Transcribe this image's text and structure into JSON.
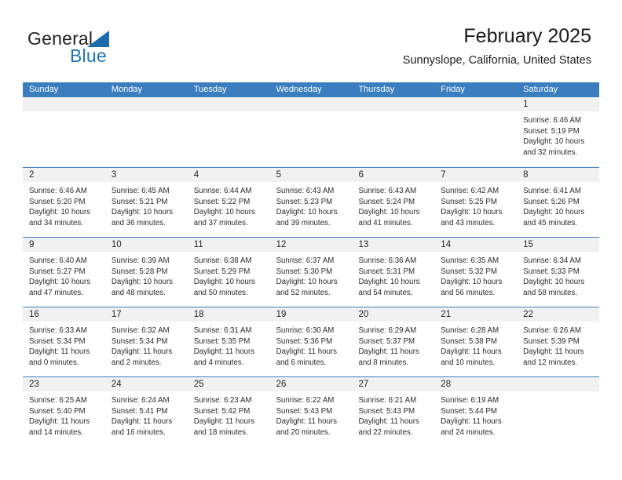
{
  "brand": {
    "name_top": "General",
    "name_bottom": "Blue",
    "accent_color": "#1b6cac"
  },
  "header": {
    "title": "February 2025",
    "location": "Sunnyslope, California, United States"
  },
  "calendar": {
    "header_color": "#3a7ebf",
    "weekdays": [
      "Sunday",
      "Monday",
      "Tuesday",
      "Wednesday",
      "Thursday",
      "Friday",
      "Saturday"
    ],
    "weeks": [
      [
        {
          "day": "",
          "lines": []
        },
        {
          "day": "",
          "lines": []
        },
        {
          "day": "",
          "lines": []
        },
        {
          "day": "",
          "lines": []
        },
        {
          "day": "",
          "lines": []
        },
        {
          "day": "",
          "lines": []
        },
        {
          "day": "1",
          "lines": [
            "Sunrise: 6:46 AM",
            "Sunset: 5:19 PM",
            "Daylight: 10 hours",
            "and 32 minutes."
          ]
        }
      ],
      [
        {
          "day": "2",
          "lines": [
            "Sunrise: 6:46 AM",
            "Sunset: 5:20 PM",
            "Daylight: 10 hours",
            "and 34 minutes."
          ]
        },
        {
          "day": "3",
          "lines": [
            "Sunrise: 6:45 AM",
            "Sunset: 5:21 PM",
            "Daylight: 10 hours",
            "and 36 minutes."
          ]
        },
        {
          "day": "4",
          "lines": [
            "Sunrise: 6:44 AM",
            "Sunset: 5:22 PM",
            "Daylight: 10 hours",
            "and 37 minutes."
          ]
        },
        {
          "day": "5",
          "lines": [
            "Sunrise: 6:43 AM",
            "Sunset: 5:23 PM",
            "Daylight: 10 hours",
            "and 39 minutes."
          ]
        },
        {
          "day": "6",
          "lines": [
            "Sunrise: 6:43 AM",
            "Sunset: 5:24 PM",
            "Daylight: 10 hours",
            "and 41 minutes."
          ]
        },
        {
          "day": "7",
          "lines": [
            "Sunrise: 6:42 AM",
            "Sunset: 5:25 PM",
            "Daylight: 10 hours",
            "and 43 minutes."
          ]
        },
        {
          "day": "8",
          "lines": [
            "Sunrise: 6:41 AM",
            "Sunset: 5:26 PM",
            "Daylight: 10 hours",
            "and 45 minutes."
          ]
        }
      ],
      [
        {
          "day": "9",
          "lines": [
            "Sunrise: 6:40 AM",
            "Sunset: 5:27 PM",
            "Daylight: 10 hours",
            "and 47 minutes."
          ]
        },
        {
          "day": "10",
          "lines": [
            "Sunrise: 6:39 AM",
            "Sunset: 5:28 PM",
            "Daylight: 10 hours",
            "and 48 minutes."
          ]
        },
        {
          "day": "11",
          "lines": [
            "Sunrise: 6:38 AM",
            "Sunset: 5:29 PM",
            "Daylight: 10 hours",
            "and 50 minutes."
          ]
        },
        {
          "day": "12",
          "lines": [
            "Sunrise: 6:37 AM",
            "Sunset: 5:30 PM",
            "Daylight: 10 hours",
            "and 52 minutes."
          ]
        },
        {
          "day": "13",
          "lines": [
            "Sunrise: 6:36 AM",
            "Sunset: 5:31 PM",
            "Daylight: 10 hours",
            "and 54 minutes."
          ]
        },
        {
          "day": "14",
          "lines": [
            "Sunrise: 6:35 AM",
            "Sunset: 5:32 PM",
            "Daylight: 10 hours",
            "and 56 minutes."
          ]
        },
        {
          "day": "15",
          "lines": [
            "Sunrise: 6:34 AM",
            "Sunset: 5:33 PM",
            "Daylight: 10 hours",
            "and 58 minutes."
          ]
        }
      ],
      [
        {
          "day": "16",
          "lines": [
            "Sunrise: 6:33 AM",
            "Sunset: 5:34 PM",
            "Daylight: 11 hours",
            "and 0 minutes."
          ]
        },
        {
          "day": "17",
          "lines": [
            "Sunrise: 6:32 AM",
            "Sunset: 5:34 PM",
            "Daylight: 11 hours",
            "and 2 minutes."
          ]
        },
        {
          "day": "18",
          "lines": [
            "Sunrise: 6:31 AM",
            "Sunset: 5:35 PM",
            "Daylight: 11 hours",
            "and 4 minutes."
          ]
        },
        {
          "day": "19",
          "lines": [
            "Sunrise: 6:30 AM",
            "Sunset: 5:36 PM",
            "Daylight: 11 hours",
            "and 6 minutes."
          ]
        },
        {
          "day": "20",
          "lines": [
            "Sunrise: 6:29 AM",
            "Sunset: 5:37 PM",
            "Daylight: 11 hours",
            "and 8 minutes."
          ]
        },
        {
          "day": "21",
          "lines": [
            "Sunrise: 6:28 AM",
            "Sunset: 5:38 PM",
            "Daylight: 11 hours",
            "and 10 minutes."
          ]
        },
        {
          "day": "22",
          "lines": [
            "Sunrise: 6:26 AM",
            "Sunset: 5:39 PM",
            "Daylight: 11 hours",
            "and 12 minutes."
          ]
        }
      ],
      [
        {
          "day": "23",
          "lines": [
            "Sunrise: 6:25 AM",
            "Sunset: 5:40 PM",
            "Daylight: 11 hours",
            "and 14 minutes."
          ]
        },
        {
          "day": "24",
          "lines": [
            "Sunrise: 6:24 AM",
            "Sunset: 5:41 PM",
            "Daylight: 11 hours",
            "and 16 minutes."
          ]
        },
        {
          "day": "25",
          "lines": [
            "Sunrise: 6:23 AM",
            "Sunset: 5:42 PM",
            "Daylight: 11 hours",
            "and 18 minutes."
          ]
        },
        {
          "day": "26",
          "lines": [
            "Sunrise: 6:22 AM",
            "Sunset: 5:43 PM",
            "Daylight: 11 hours",
            "and 20 minutes."
          ]
        },
        {
          "day": "27",
          "lines": [
            "Sunrise: 6:21 AM",
            "Sunset: 5:43 PM",
            "Daylight: 11 hours",
            "and 22 minutes."
          ]
        },
        {
          "day": "28",
          "lines": [
            "Sunrise: 6:19 AM",
            "Sunset: 5:44 PM",
            "Daylight: 11 hours",
            "and 24 minutes."
          ]
        },
        {
          "day": "",
          "lines": []
        }
      ]
    ]
  }
}
